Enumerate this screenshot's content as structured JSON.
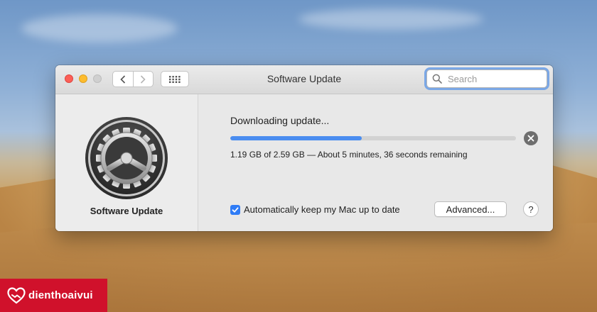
{
  "window": {
    "title": "Software Update",
    "search_placeholder": "Search"
  },
  "sidebar": {
    "icon": "gear-icon",
    "label": "Software Update"
  },
  "update": {
    "status": "Downloading update...",
    "progress_fraction": 0.4595,
    "detail": "1.19 GB of 2.59 GB — About 5 minutes, 36 seconds remaining"
  },
  "options": {
    "auto_update_checked": true,
    "auto_update_label": "Automatically keep my Mac up to date",
    "advanced_label": "Advanced...",
    "help_label": "?"
  },
  "watermark": {
    "text": "dienthoaivui"
  },
  "colors": {
    "accent": "#4a8df0",
    "checkbox": "#2f7cf6",
    "watermark_bg": "#d0112b"
  }
}
